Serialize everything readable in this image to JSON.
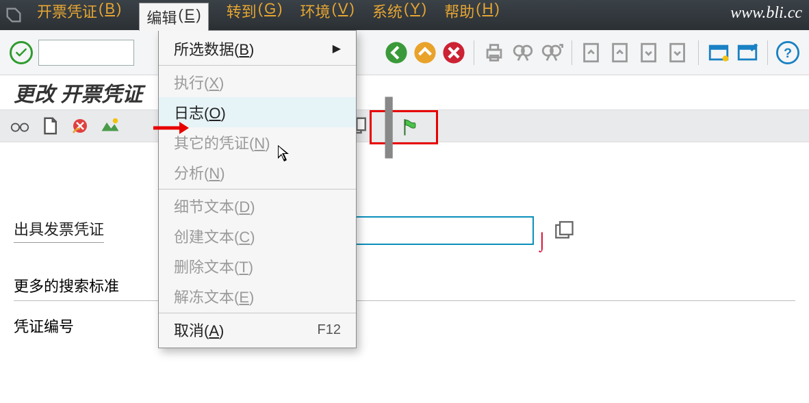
{
  "watermark": "www.bli.cc",
  "menu": {
    "item0": {
      "label": "开票凭证",
      "key": "B"
    },
    "item1": {
      "label": "编辑",
      "key": "E"
    },
    "item2": {
      "label": "转到",
      "key": "G"
    },
    "item3": {
      "label": "环境",
      "key": "V"
    },
    "item4": {
      "label": "系统",
      "key": "Y"
    },
    "item5": {
      "label": "帮助",
      "key": "H"
    }
  },
  "dropdown": {
    "selected_data": {
      "label": "所选数据",
      "key": "B"
    },
    "execute": {
      "label": "执行",
      "key": "X"
    },
    "log": {
      "label": "日志",
      "key": "O"
    },
    "other_doc": {
      "label": "其它的凭证",
      "key": "N"
    },
    "analyze": {
      "label": "分析",
      "key": "N"
    },
    "detail_text": {
      "label": "细节文本",
      "key": "D"
    },
    "create_text": {
      "label": "创建文本",
      "key": "C"
    },
    "delete_text": {
      "label": "删除文本",
      "key": "T"
    },
    "unfreeze_text": {
      "label": "解冻文本",
      "key": "E"
    },
    "cancel": {
      "label": "取消",
      "key": "A",
      "shortcut": "F12"
    }
  },
  "page_title": "更改 开票凭证",
  "form": {
    "invoice_doc_label": "出具发票凭证",
    "invoice_doc_value": "",
    "more_criteria_label": "更多的搜索标准",
    "doc_number_label": "凭证编号",
    "doc_number_value": ""
  }
}
